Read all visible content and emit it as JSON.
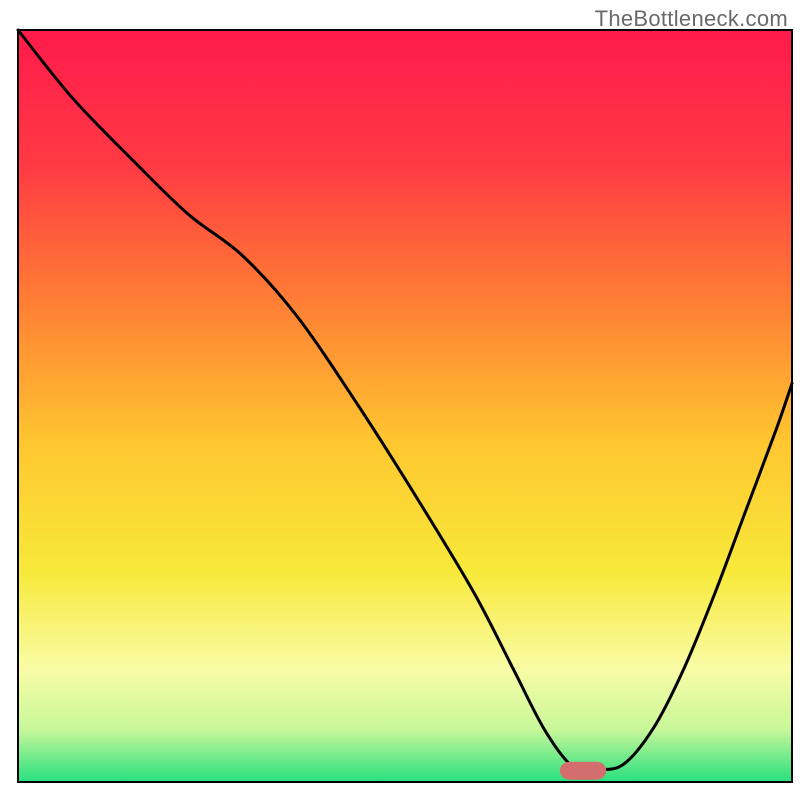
{
  "watermark": "TheBottleneck.com",
  "chart_data": {
    "type": "line",
    "title": "",
    "xlabel": "",
    "ylabel": "",
    "xlim": [
      0,
      100
    ],
    "ylim": [
      0,
      100
    ],
    "grid": false,
    "legend": false,
    "background_gradient": {
      "stops": [
        {
          "offset": 0.0,
          "color": "#ff1a4b"
        },
        {
          "offset": 0.18,
          "color": "#ff3a44"
        },
        {
          "offset": 0.35,
          "color": "#ff7a35"
        },
        {
          "offset": 0.55,
          "color": "#ffc730"
        },
        {
          "offset": 0.72,
          "color": "#f7e93a"
        },
        {
          "offset": 0.85,
          "color": "#f9fca6"
        },
        {
          "offset": 0.93,
          "color": "#c8f79a"
        },
        {
          "offset": 1.0,
          "color": "#27e07e"
        }
      ]
    },
    "series": [
      {
        "name": "bottleneck-curve",
        "color": "#000000",
        "stroke_width": 3,
        "x": [
          0,
          7,
          15,
          22,
          29,
          36,
          44,
          52,
          59,
          64,
          68,
          71.5,
          74,
          78,
          82,
          86,
          90,
          94,
          98,
          100
        ],
        "y": [
          100,
          91,
          82.5,
          75.5,
          70,
          62,
          50,
          37,
          25,
          15,
          7,
          2.2,
          1.8,
          2.2,
          7,
          15,
          25,
          36,
          47,
          53
        ]
      }
    ],
    "marker": {
      "name": "optimal-marker",
      "color": "#d36d6e",
      "x": 73,
      "y": 1.5,
      "width": 6,
      "height": 2.4,
      "rx": 1.3
    },
    "frame": {
      "inset_left": 18,
      "inset_right": 8,
      "inset_top": 30,
      "inset_bottom": 18,
      "stroke": "#000000",
      "stroke_width": 2
    }
  }
}
